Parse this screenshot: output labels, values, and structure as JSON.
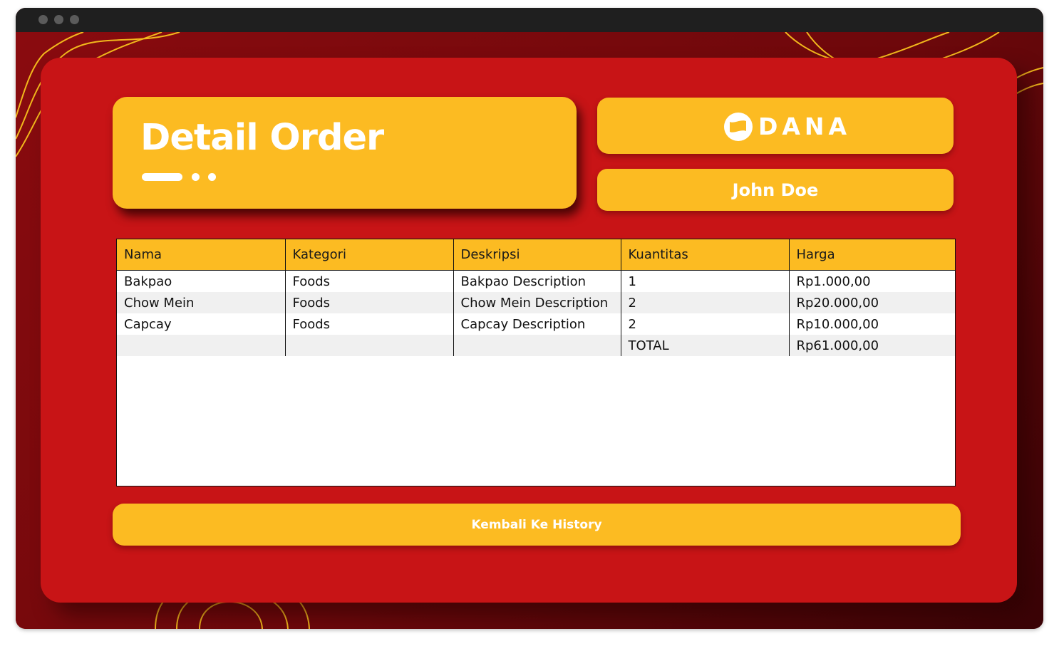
{
  "colors": {
    "accent": "#fcbb22",
    "card_red": "#c81416",
    "background_dark_red": "#7a0a0e",
    "titlebar": "#1f1f1f"
  },
  "header": {
    "title": "Detail Order"
  },
  "payment": {
    "brand": "DANA",
    "icon": "dana-logo-icon"
  },
  "user": {
    "name": "John Doe"
  },
  "table": {
    "columns": [
      "Nama",
      "Kategori",
      "Deskripsi",
      "Kuantitas",
      "Harga"
    ],
    "rows": [
      [
        "Bakpao",
        "Foods",
        "Bakpao Description",
        "1",
        "Rp1.000,00"
      ],
      [
        "Chow Mein",
        "Foods",
        "Chow Mein Description",
        "2",
        "Rp20.000,00"
      ],
      [
        "Capcay",
        "Foods",
        "Capcay Description",
        "2",
        "Rp10.000,00"
      ],
      [
        "",
        "",
        "",
        "TOTAL",
        "Rp61.000,00"
      ]
    ]
  },
  "footer": {
    "back_label": "Kembali Ke History"
  }
}
